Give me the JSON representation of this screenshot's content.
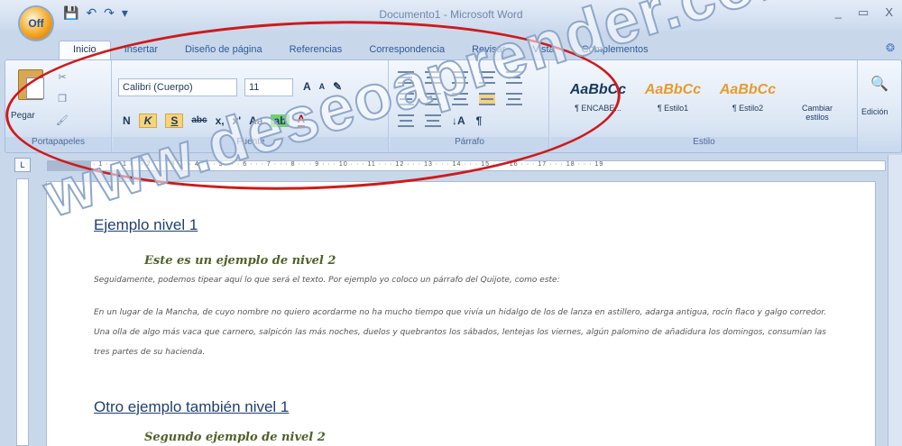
{
  "window": {
    "title": "Documento1 - Microsoft Word",
    "controls": [
      "_",
      "▭",
      "X"
    ]
  },
  "office_button": {
    "label": "Off"
  },
  "qat": {
    "save": "💾",
    "undo": "↶",
    "redo": "↷",
    "more": "▾"
  },
  "tabs": [
    "Inicio",
    "Insertar",
    "Diseño de página",
    "Referencias",
    "Correspondencia",
    "Revisar",
    "Vista",
    "Complementos"
  ],
  "help_icon": "help-icon",
  "ribbon": {
    "clipboard": {
      "paste_label": "Pegar",
      "group_label": "Portapapeles"
    },
    "font": {
      "font_name": "Calibri (Cuerpo)",
      "font_size": "11",
      "grow": "A",
      "shrink": "A",
      "clear": "✎",
      "bold": "N",
      "italic": "K",
      "underline": "S",
      "strike": "abc",
      "sub": "x,",
      "sup": "x'",
      "case": "Aa",
      "highlight": "ab",
      "color": "A",
      "group_label": "Fuente"
    },
    "paragraph": {
      "group_label": "Párrafo",
      "sort": "↓A",
      "pilcrow": "¶"
    },
    "styles": {
      "items": [
        {
          "sample": "AaBbCc",
          "name": "¶ ENCABE...",
          "color": "#17365d"
        },
        {
          "sample": "AaBbCc",
          "name": "¶ Estilo1",
          "color": "#e59c2a"
        },
        {
          "sample": "AaBbCc",
          "name": "¶ Estilo2",
          "color": "#e59c2a"
        }
      ],
      "change": "Cambiar estilos",
      "group_label": "Estilo",
      "edit": "Edición"
    }
  },
  "ruler_text": "· 1 · · · 1 · · · 2 · · · 3 · · · 4 · · · 5 · · · 6 · · · 7 · · · 8 · · · 9 · · · 10 · · · 11 · · · 12 · · · 13 · · · 14 · · · 15 · · · 16 · · · 17 · · · 18 · · · 19",
  "document": {
    "h1_a": "Ejemplo nivel 1",
    "h2_a": "Este es un ejemplo de nivel 2",
    "p1": "Seguidamente, podemos tipear aquí lo que será el texto. Por ejemplo yo coloco un párrafo del Quijote, como este:",
    "p2": "En un lugar de la Mancha, de cuyo nombre no quiero acordarme no ha mucho tiempo que vivía un hidalgo de los de lanza en astillero, adarga antigua, rocín flaco y galgo corredor. Una olla de algo más vaca que carnero, salpicón las más noches, duelos y quebrantos los sábados, lentejas los viernes, algún palomino de añadidura los domingos, consumían las tres partes de su hacienda.",
    "h1_b": "Otro ejemplo también nivel 1",
    "h2_b": "Segundo ejemplo de nivel 2"
  },
  "watermark": "www.deseoaprender.com"
}
